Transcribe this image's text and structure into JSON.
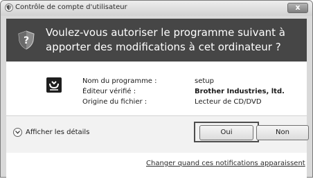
{
  "window": {
    "title": "Contrôle de compte d'utilisateur",
    "close_glyph": "x",
    "icons": {
      "title": "uac-shield-icon",
      "close": "close-icon"
    }
  },
  "header": {
    "question": "Voulez-vous autoriser le programme suivant à apporter des modifications à cet ordinateur ?",
    "icon": "shield-question-icon",
    "background": "#464646"
  },
  "program": {
    "icon": "program-icon",
    "rows": [
      {
        "label": "Nom du programme :",
        "value": "setup"
      },
      {
        "label": "Éditeur vérifié :",
        "value": "Brother Industries, ltd."
      },
      {
        "label": "Origine du fichier :",
        "value": "Lecteur de CD/DVD"
      }
    ]
  },
  "footer": {
    "details_label": "Afficher les détails",
    "details_icon": "chevron-down-icon",
    "yes_label": "Oui",
    "no_label": "Non",
    "notifications_link": "Changer quand ces notifications apparaissent"
  }
}
